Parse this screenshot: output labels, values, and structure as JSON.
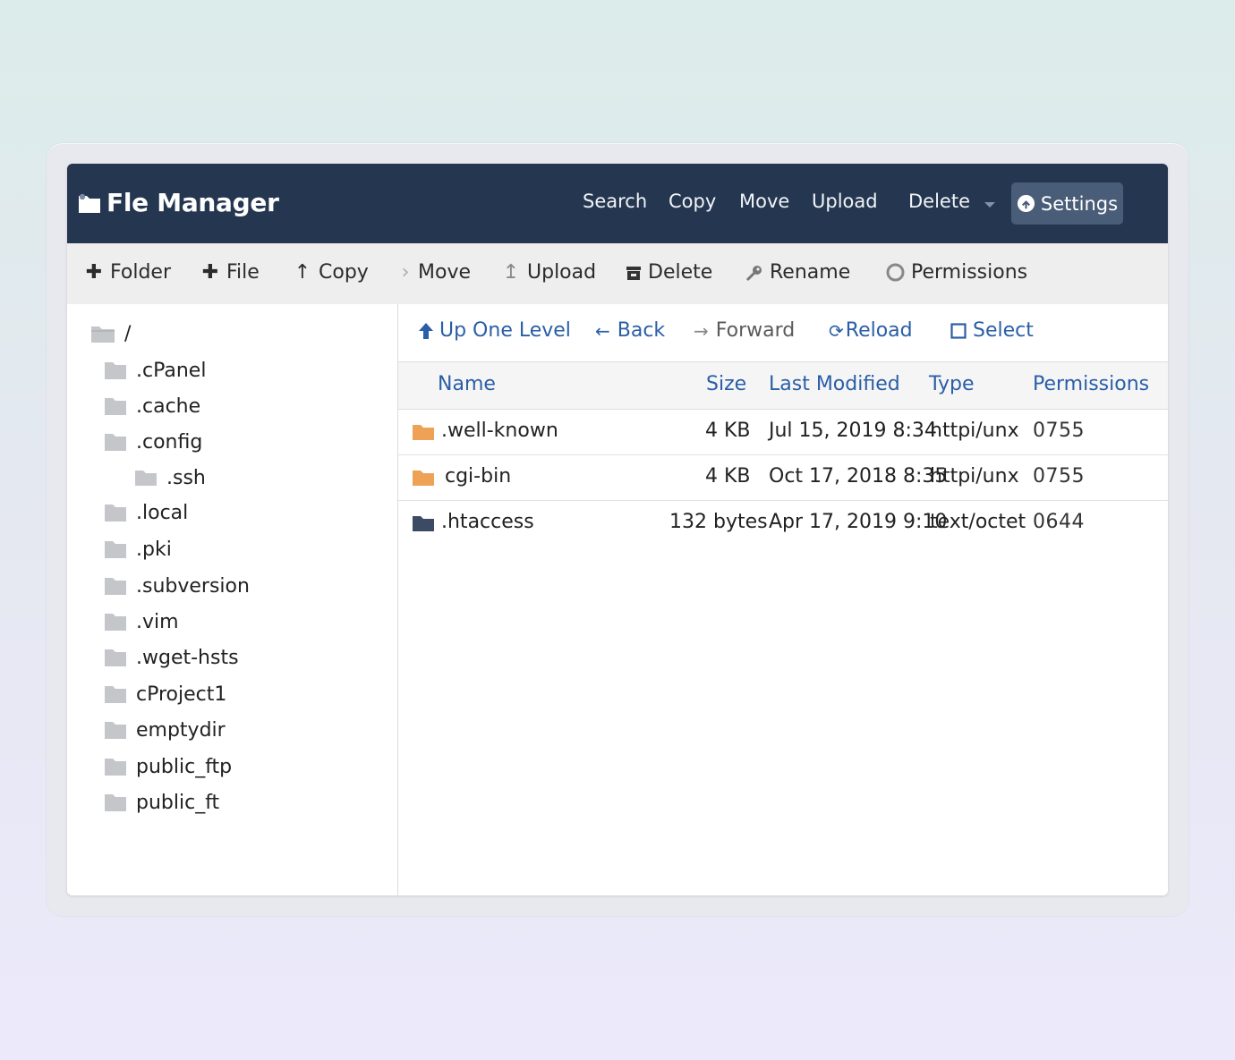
{
  "app": {
    "title": "Fle Manager"
  },
  "topnav": {
    "items": [
      "Search",
      "Copy",
      "Move",
      "Upload",
      "Delete"
    ],
    "settings_label": "Settings"
  },
  "toolbar": {
    "items": [
      {
        "icon": "plus-icon",
        "label": "Folder"
      },
      {
        "icon": "plus-icon",
        "label": "File"
      },
      {
        "icon": "arrow-up-icon",
        "label": "Copy"
      },
      {
        "icon": "chevron-right-icon",
        "label": "Move"
      },
      {
        "icon": "upload-icon",
        "label": "Upload"
      },
      {
        "icon": "trash-icon",
        "label": "Delete"
      },
      {
        "icon": "key-icon",
        "label": "Rename"
      },
      {
        "icon": "circle-icon",
        "label": "Permissions"
      }
    ]
  },
  "tree": {
    "root": "/",
    "items": [
      ".cPanel",
      ".cache",
      ".config",
      ".ssh",
      ".local",
      ".pki",
      ".subversion",
      ".vim",
      ".wget-hsts",
      "cProject1",
      "emptydir",
      "public_ftp",
      "public_ft"
    ]
  },
  "navbar": {
    "up_one_level": "Up One Level",
    "back": "Back",
    "forward": "Forward",
    "reload": "Reload",
    "select": "Select"
  },
  "table": {
    "headers": [
      "Name",
      "Size",
      "Last Modified",
      "Type",
      "Permissions"
    ],
    "rows": [
      {
        "name": ".well-known",
        "size": "4 KB",
        "modified": "Jul 15, 2019 8:34",
        "type": "httpi/unx",
        "perms": "0755",
        "icon": "folder-orange-icon"
      },
      {
        "name": "cgi-bin",
        "size": "4 KB",
        "modified": "Oct 17, 2018 8:35",
        "type": "httpi/unx",
        "perms": "0755",
        "icon": "folder-orange-icon"
      },
      {
        "name": ".htaccess",
        "size": "132 bytes",
        "modified": "Apr 17, 2019 9:10",
        "type": "text/octet",
        "perms": "0644",
        "icon": "folder-dark-icon"
      }
    ]
  },
  "colors": {
    "header_bg": "#253750",
    "link": "#2a5ea6",
    "folder_orange": "#eda255",
    "folder_dark": "#3b4b63",
    "folder_gray": "#c4c6ca"
  }
}
